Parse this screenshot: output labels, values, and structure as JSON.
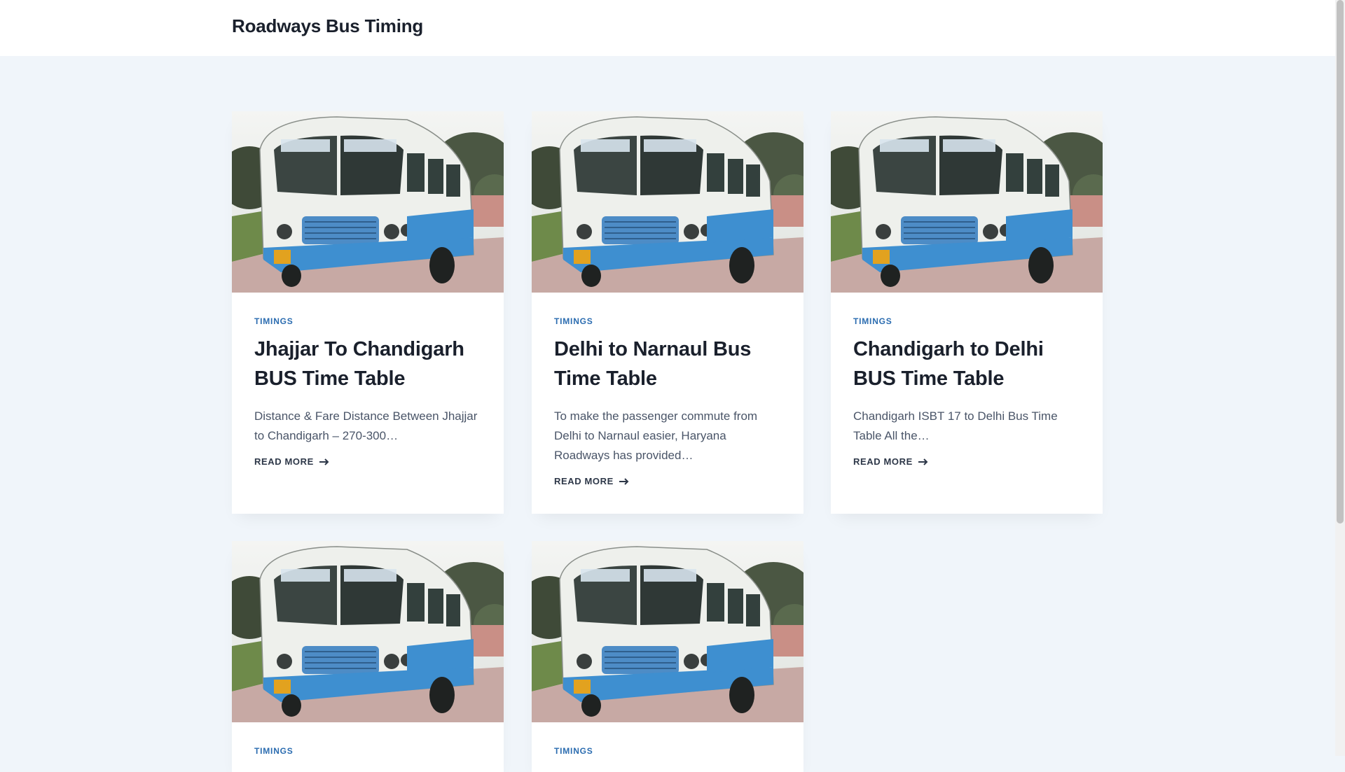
{
  "site": {
    "title": "Roadways Bus Timing"
  },
  "posts": [
    {
      "category": "TIMINGS",
      "title": "Jhajjar To Chandigarh BUS Time Table",
      "excerpt": "Distance & Fare Distance Between Jhajjar to Chandigarh – 270-300…",
      "read_more": "READ MORE"
    },
    {
      "category": "TIMINGS",
      "title": "Delhi to Narnaul Bus Time Table",
      "excerpt": "To make the passenger commute from Delhi to Narnaul easier, Haryana Roadways has provided…",
      "read_more": "READ MORE"
    },
    {
      "category": "TIMINGS",
      "title": "Chandigarh to Delhi BUS Time Table",
      "excerpt": "Chandigarh ISBT 17 to Delhi Bus Time Table All the…",
      "read_more": "READ MORE"
    },
    {
      "category": "TIMINGS"
    },
    {
      "category": "TIMINGS"
    }
  ],
  "colors": {
    "accent": "#2b6cb0",
    "page_bg": "#f0f5fa",
    "card_bg": "#ffffff"
  },
  "icons": {
    "read_more": "arrow-right-icon"
  }
}
